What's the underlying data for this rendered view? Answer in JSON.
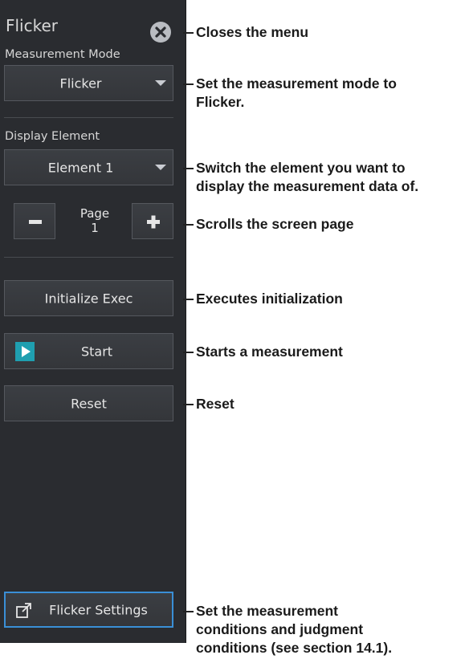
{
  "panel": {
    "title": "Flicker",
    "measurement_mode_label": "Measurement Mode",
    "measurement_mode_value": "Flicker",
    "display_element_label": "Display Element",
    "display_element_value": "Element 1",
    "page_label": "Page",
    "page_value": "1",
    "initialize_label": "Initialize Exec",
    "start_label": "Start",
    "reset_label": "Reset",
    "settings_label": "Flicker Settings"
  },
  "annotations": {
    "close": "Closes the menu",
    "mode_line1": "Set the measurement mode to",
    "mode_line2": "Flicker.",
    "element_line1": "Switch the element you want to",
    "element_line2": "display the measurement data of.",
    "page": "Scrolls the screen page",
    "initialize": "Executes initialization",
    "start": "Starts a measurement",
    "reset": "Reset",
    "settings_line1": "Set the measurement",
    "settings_line2": "conditions and judgment",
    "settings_line3": "conditions (see section 14.1)."
  },
  "colors": {
    "panel_bg": "#2a2c30",
    "button_bg": "#383b40",
    "accent_blue": "#3a8fd6",
    "play_teal": "#1f9fb0"
  },
  "icons": [
    "close-icon",
    "dropdown-caret-icon",
    "minus-icon",
    "plus-icon",
    "play-icon",
    "external-window-icon"
  ]
}
